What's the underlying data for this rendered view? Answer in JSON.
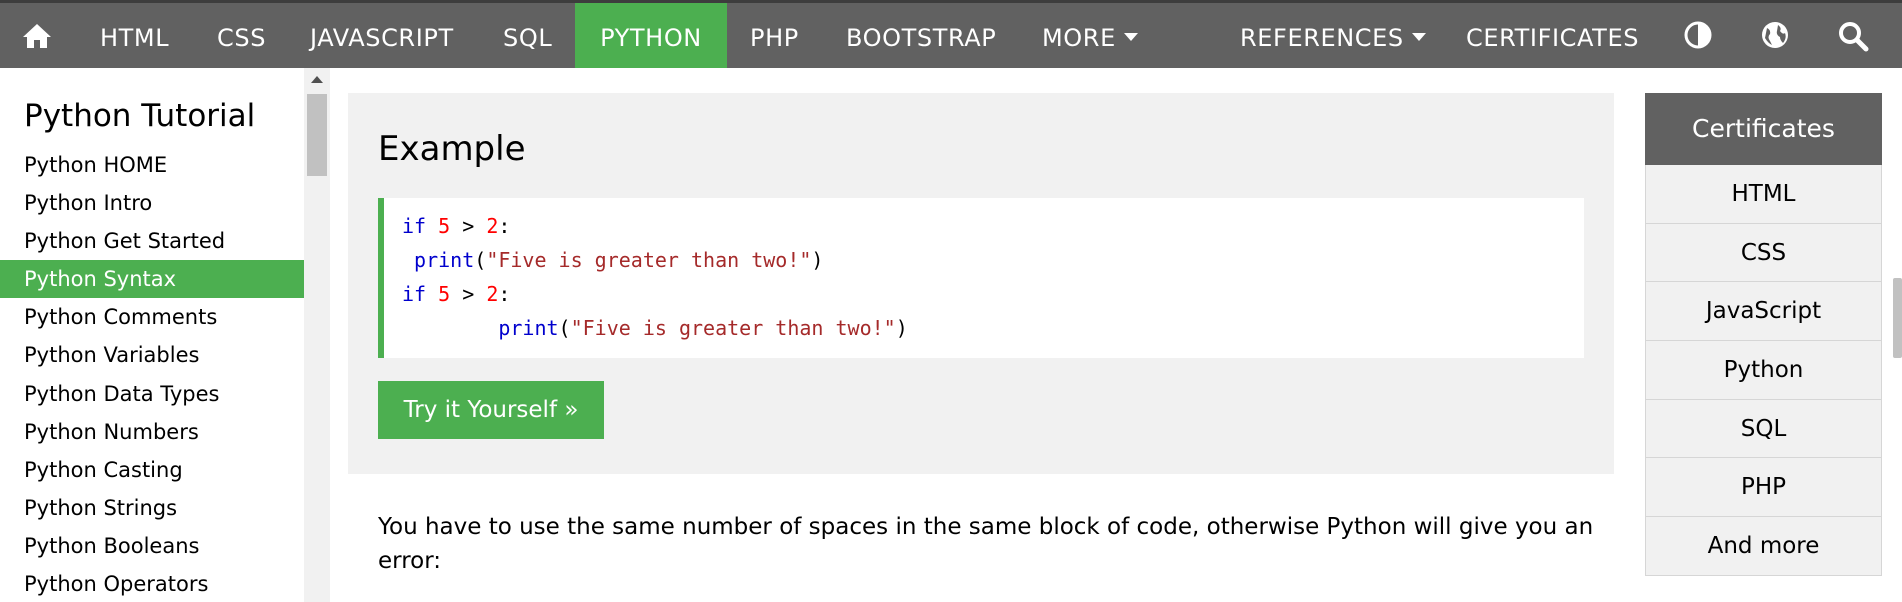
{
  "topnav": {
    "home_icon": "home-icon",
    "items": [
      {
        "label": "HTML"
      },
      {
        "label": "CSS"
      },
      {
        "label": "JAVASCRIPT"
      },
      {
        "label": "SQL"
      },
      {
        "label": "PYTHON",
        "active": true
      },
      {
        "label": "PHP"
      },
      {
        "label": "BOOTSTRAP"
      },
      {
        "label": "MORE"
      },
      {
        "label": "REFERENCES"
      },
      {
        "label": "CERTIFICATES"
      }
    ],
    "icons": [
      "contrast-icon",
      "globe-icon",
      "search-icon"
    ],
    "colors": {
      "bar": "#616161",
      "active": "#4caf50"
    }
  },
  "sidebar": {
    "title": "Python Tutorial",
    "items": [
      {
        "label": "Python HOME"
      },
      {
        "label": "Python Intro"
      },
      {
        "label": "Python Get Started"
      },
      {
        "label": "Python Syntax",
        "active": true
      },
      {
        "label": "Python Comments"
      },
      {
        "label": "Python Variables"
      },
      {
        "label": "Python Data Types"
      },
      {
        "label": "Python Numbers"
      },
      {
        "label": "Python Casting"
      },
      {
        "label": "Python Strings"
      },
      {
        "label": "Python Booleans"
      },
      {
        "label": "Python Operators"
      }
    ]
  },
  "example": {
    "title": "Example",
    "code": [
      [
        {
          "t": "if",
          "c": "kw"
        },
        {
          "t": " ",
          "c": "pun"
        },
        {
          "t": "5",
          "c": "num"
        },
        {
          "t": " > ",
          "c": "pun"
        },
        {
          "t": "2",
          "c": "num"
        },
        {
          "t": ":",
          "c": "pun"
        }
      ],
      [
        {
          "t": " ",
          "c": "pun"
        },
        {
          "t": "print",
          "c": "kw"
        },
        {
          "t": "(",
          "c": "pun"
        },
        {
          "t": "\"Five is greater than two!\"",
          "c": "str"
        },
        {
          "t": ")",
          "c": "pun"
        }
      ],
      [
        {
          "t": "if",
          "c": "kw"
        },
        {
          "t": " ",
          "c": "pun"
        },
        {
          "t": "5",
          "c": "num"
        },
        {
          "t": " > ",
          "c": "pun"
        },
        {
          "t": "2",
          "c": "num"
        },
        {
          "t": ":",
          "c": "pun"
        }
      ],
      [
        {
          "t": "        ",
          "c": "pun"
        },
        {
          "t": "print",
          "c": "kw"
        },
        {
          "t": "(",
          "c": "pun"
        },
        {
          "t": "\"Five is greater than two!\"",
          "c": "str"
        },
        {
          "t": ")",
          "c": "pun"
        }
      ]
    ],
    "button_label": "Try it Yourself »"
  },
  "paragraph": "You have to use the same number of spaces in the same block of code, otherwise Python will give you an error:",
  "certificates": {
    "header": "Certificates",
    "items": [
      "HTML",
      "CSS",
      "JavaScript",
      "Python",
      "SQL",
      "PHP",
      "And more"
    ]
  }
}
